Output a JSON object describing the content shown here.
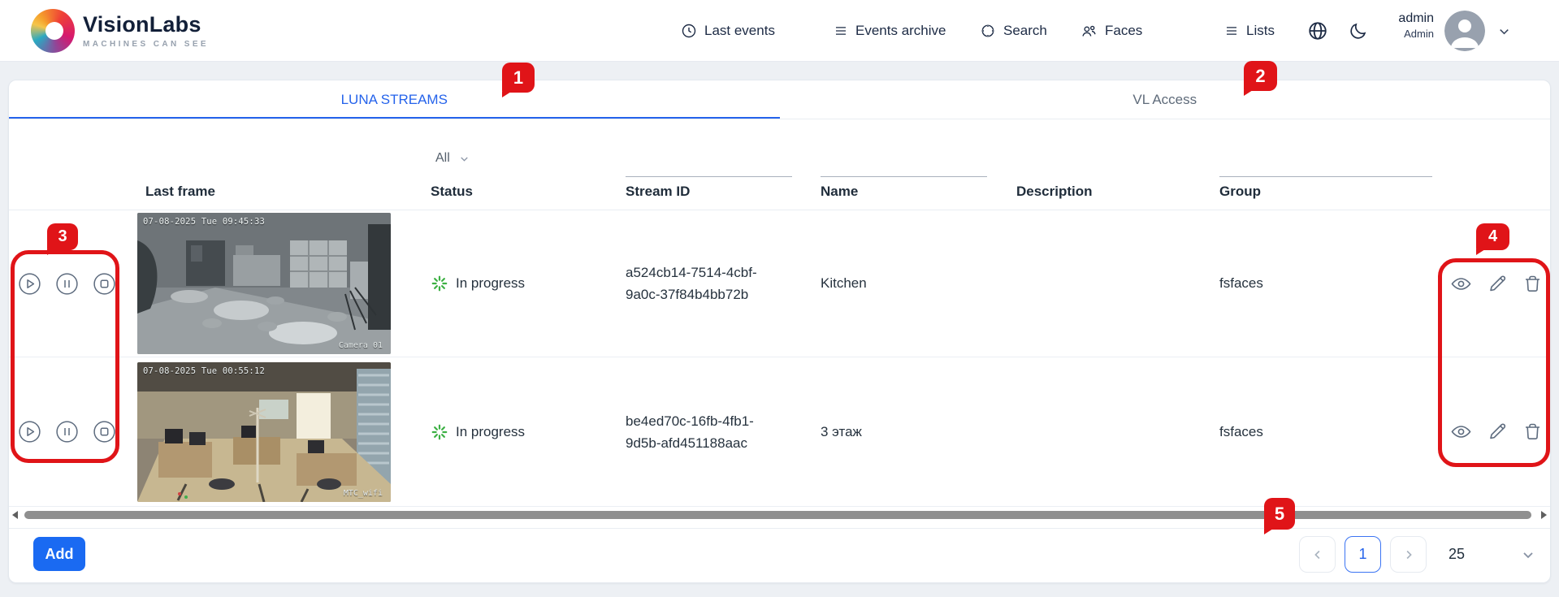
{
  "brand": {
    "name": "VisionLabs",
    "tagline": "MACHINES CAN SEE"
  },
  "nav": {
    "items": [
      {
        "label": "Last events"
      },
      {
        "label": "Events archive"
      },
      {
        "label": "Search"
      },
      {
        "label": "Faces"
      },
      {
        "label": "Lists"
      }
    ],
    "user": {
      "name": "admin",
      "role": "Admin"
    }
  },
  "tabs": {
    "luna": "LUNA STREAMS",
    "vl": "VL Access"
  },
  "filters": {
    "status": "All"
  },
  "table": {
    "headers": {
      "last_frame": "Last frame",
      "status": "Status",
      "stream_id": "Stream ID",
      "name": "Name",
      "description": "Description",
      "group": "Group"
    },
    "rows": [
      {
        "timestamp": "07-08-2025 Tue 09:45:33",
        "camera_label": "Camera 01",
        "status": "In progress",
        "stream_id_l1": "a524cb14-7514-4cbf-",
        "stream_id_l2": "9a0c-37f84b4bb72b",
        "name": "Kitchen",
        "description": "",
        "group": "fsfaces"
      },
      {
        "timestamp": "07-08-2025 Tue 00:55:12",
        "camera_label": "MTC_wifi",
        "status": "In progress",
        "stream_id_l1": "be4ed70c-16fb-4fb1-",
        "stream_id_l2": "9d5b-afd451188aac",
        "name": "3 этаж",
        "description": "",
        "group": "fsfaces"
      }
    ]
  },
  "annotations": {
    "b1": "1",
    "b2": "2",
    "b3": "3",
    "b4": "4",
    "b5": "5"
  },
  "footer": {
    "add": "Add",
    "page": "1",
    "page_size": "25"
  },
  "colors": {
    "accent_blue": "#2563eb",
    "annotation_red": "#e01418",
    "status_green": "#3cb043"
  }
}
